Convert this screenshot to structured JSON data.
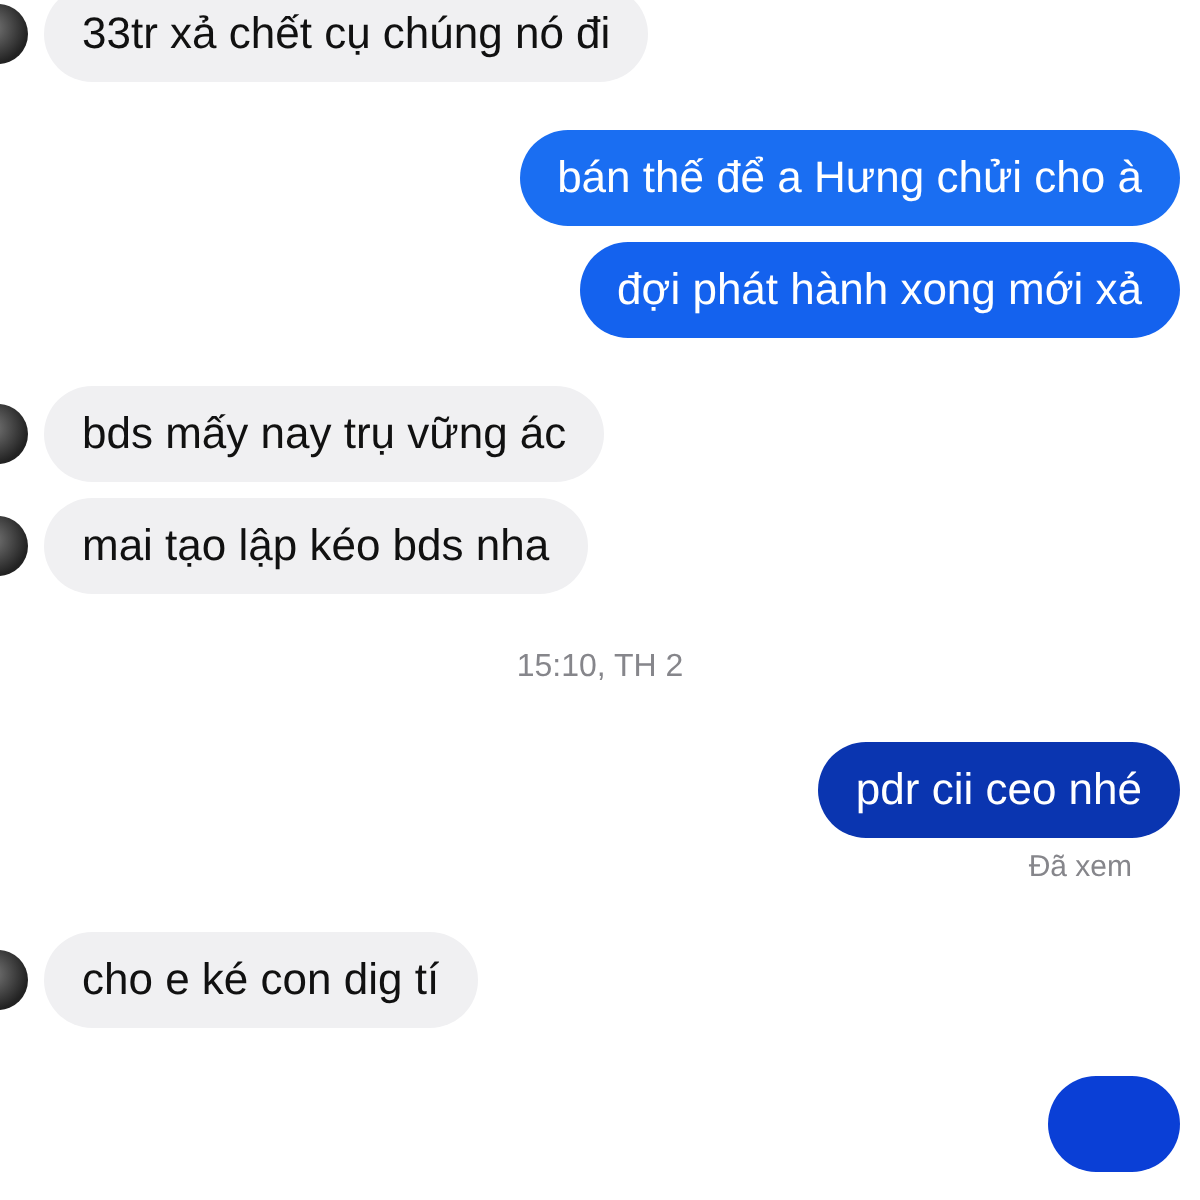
{
  "messages": [
    {
      "kind": "incoming",
      "text": "33tr xả chết cụ chúng nó đi"
    },
    {
      "kind": "outgoing",
      "text": "bán thế để a Hưng chửi cho à",
      "color": "#1a6ef2"
    },
    {
      "kind": "outgoing",
      "text": "đợi phát hành xong mới xả",
      "color": "#1462ee"
    },
    {
      "kind": "incoming",
      "text": "bds mấy nay trụ vững ác"
    },
    {
      "kind": "incoming",
      "text": "mai tạo lập kéo bds nha"
    },
    {
      "kind": "timestamp",
      "text": "15:10, TH 2"
    },
    {
      "kind": "outgoing",
      "text": "pdr cii ceo nhé",
      "color": "#0a35b0"
    },
    {
      "kind": "status",
      "text": "Đã xem"
    },
    {
      "kind": "incoming",
      "text": "cho e ké con dig tí"
    },
    {
      "kind": "outgoing",
      "color": "#0a3fd6"
    }
  ]
}
